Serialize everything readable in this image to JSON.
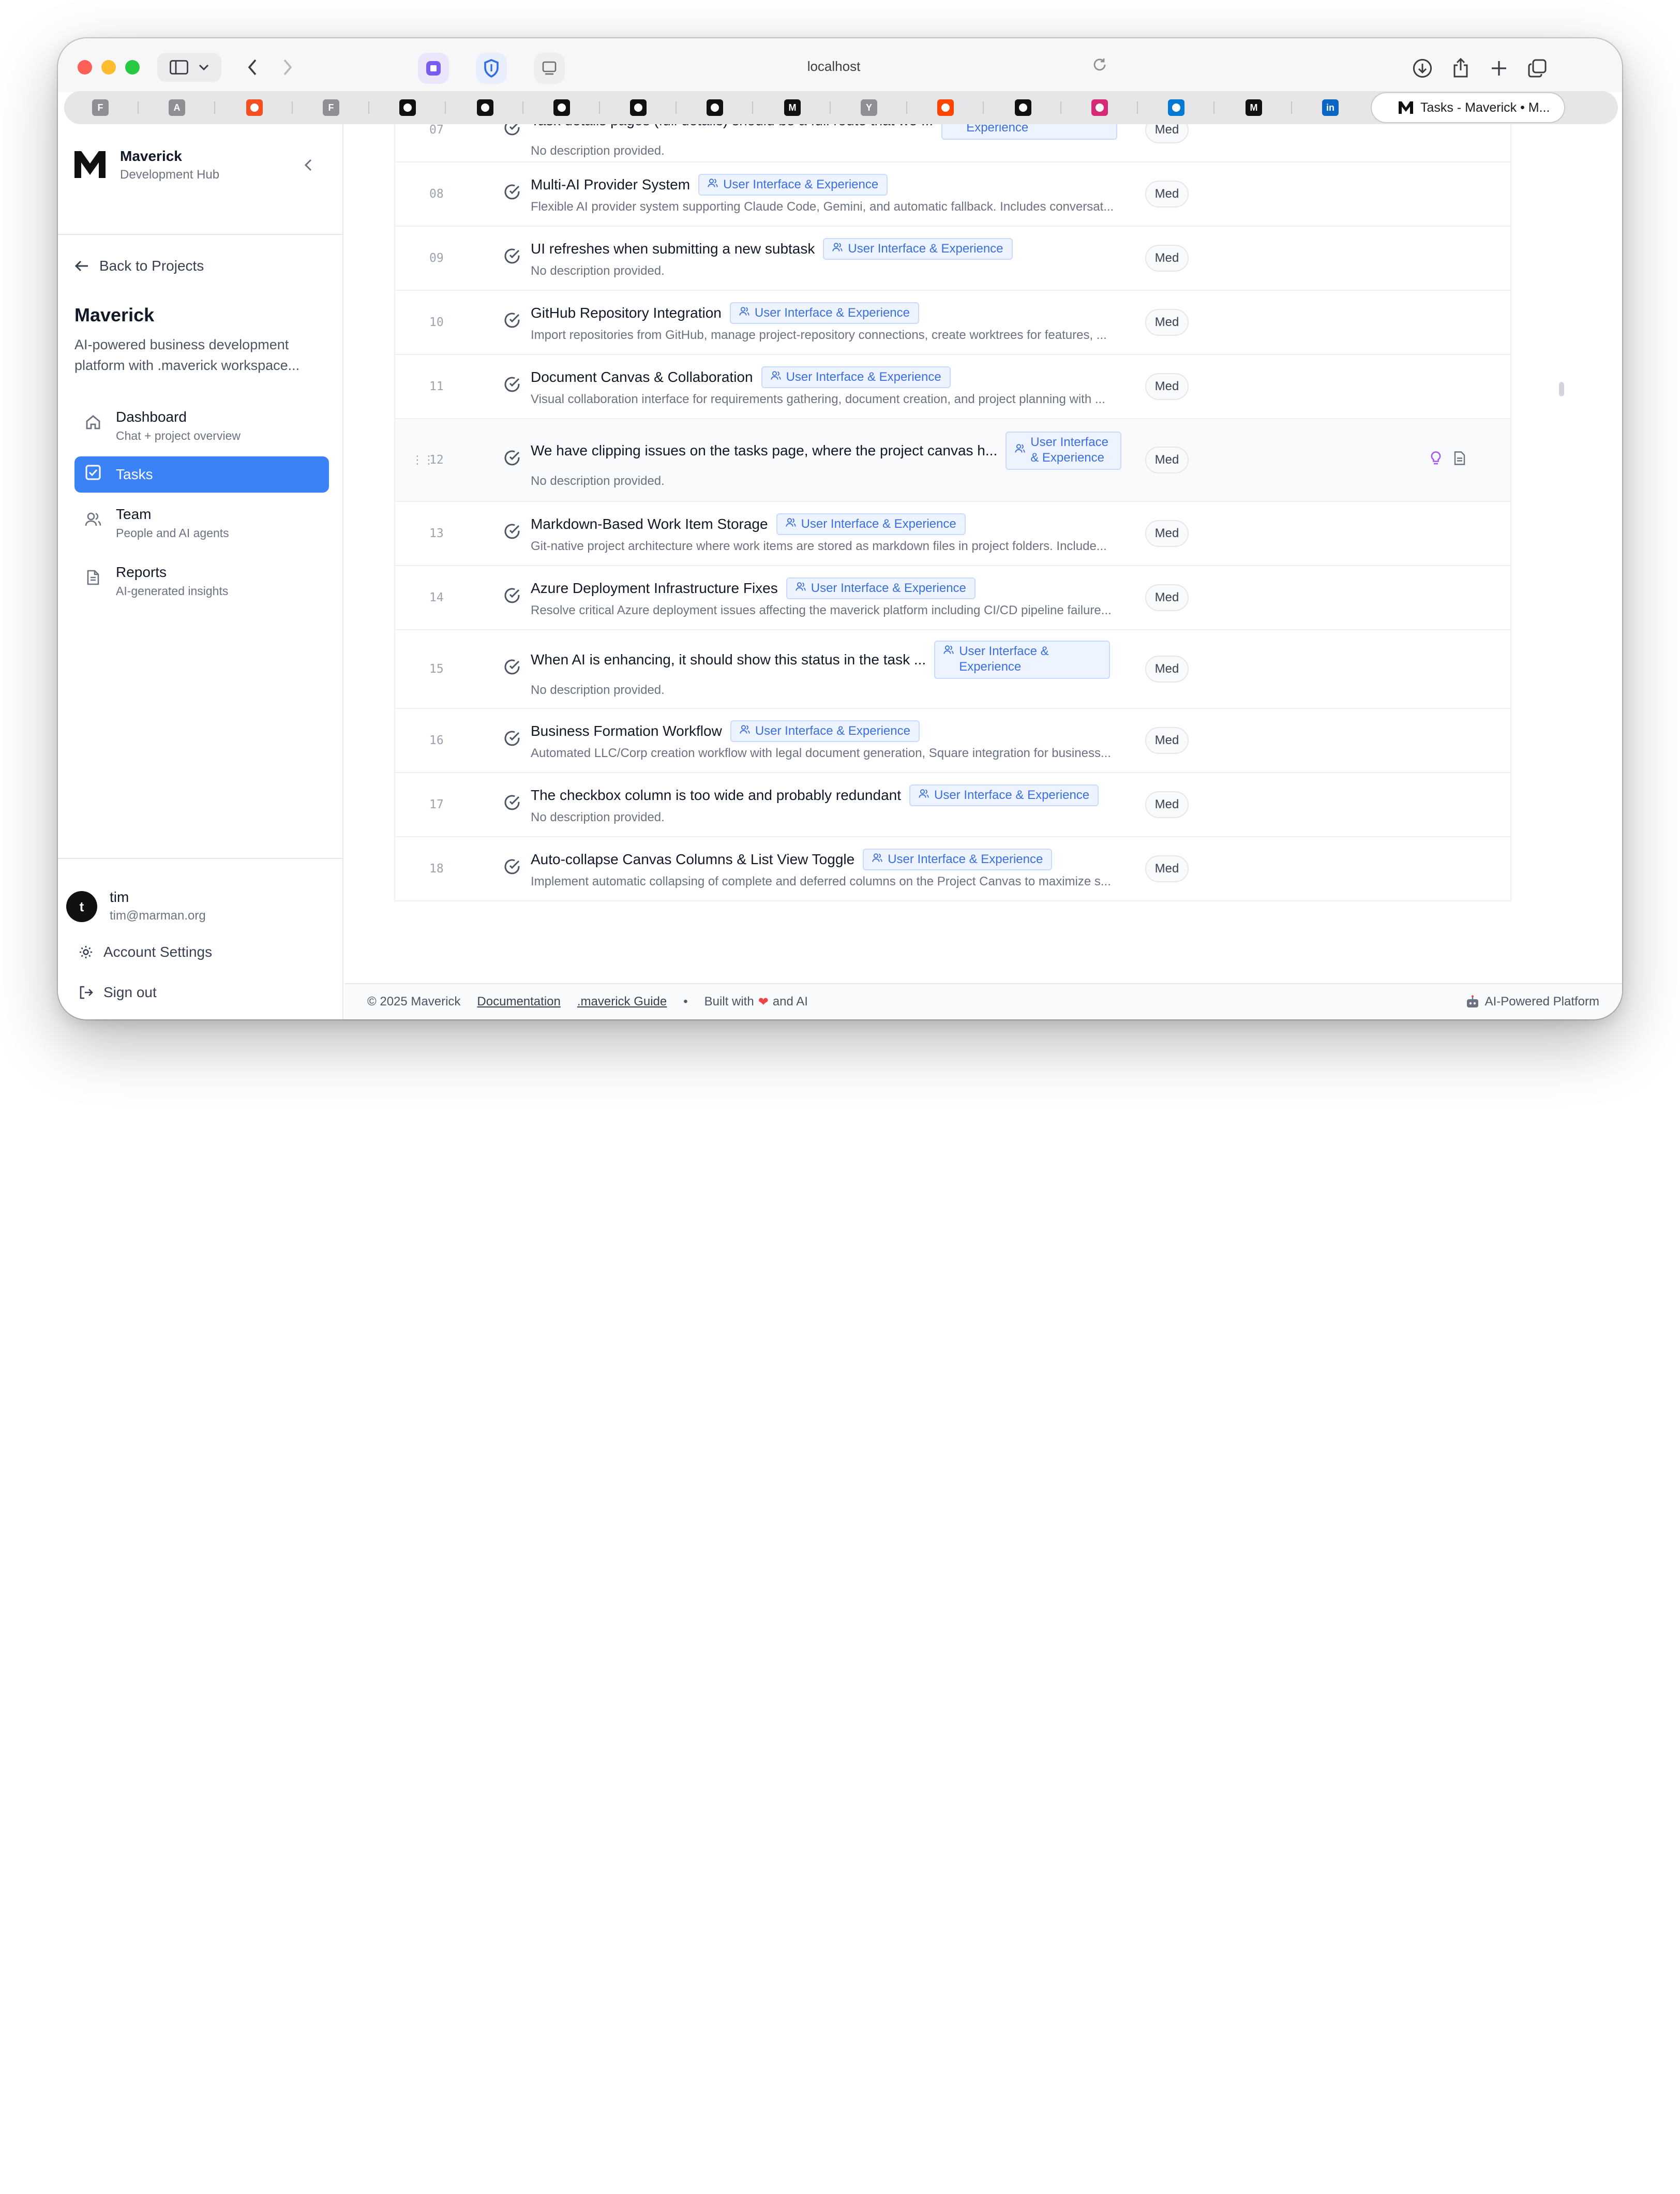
{
  "browser": {
    "address": "localhost",
    "active_tab_title": "Tasks - Maverick • M...",
    "pinned_tabs": [
      {
        "icon": "F",
        "color": "#8e8e93"
      },
      {
        "icon": "A",
        "color": "#8e8e93"
      },
      {
        "icon": "microsoft-icon",
        "color": "#f25022"
      },
      {
        "icon": "F",
        "color": "#8e8e93"
      },
      {
        "icon": "vercel-icon",
        "color": "#111111"
      },
      {
        "icon": "vercel-icon",
        "color": "#111111"
      },
      {
        "icon": "square-app-icon",
        "color": "#111111"
      },
      {
        "icon": "github-icon",
        "color": "#111111"
      },
      {
        "icon": "github-icon",
        "color": "#111111"
      },
      {
        "icon": "M",
        "color": "#111111"
      },
      {
        "icon": "Y",
        "color": "#8e8e93"
      },
      {
        "icon": "reddit-icon",
        "color": "#ff4500"
      },
      {
        "icon": "github-icon",
        "color": "#111111"
      },
      {
        "icon": "instagram-icon",
        "color": "#d62976"
      },
      {
        "icon": "azure-icon",
        "color": "#0078d4"
      },
      {
        "icon": "M",
        "color": "#111111"
      },
      {
        "icon": "in",
        "color": "#0a66c2"
      }
    ]
  },
  "sidebar": {
    "brand_name": "Maverick",
    "brand_sub": "Development Hub",
    "back_label": "Back to Projects",
    "project_name": "Maverick",
    "project_desc": "AI-powered business development platform with .maverick workspace...",
    "nav": [
      {
        "title": "Dashboard",
        "sub": "Chat + project overview",
        "icon": "home-icon"
      },
      {
        "title": "Tasks",
        "sub": "",
        "icon": "checkbox-icon"
      },
      {
        "title": "Team",
        "sub": "People and AI agents",
        "icon": "users-icon"
      },
      {
        "title": "Reports",
        "sub": "AI-generated insights",
        "icon": "document-icon"
      }
    ],
    "user": {
      "initial": "t",
      "name": "tim",
      "email": "tim@marman.org"
    },
    "account_settings": "Account Settings",
    "sign_out": "Sign out"
  },
  "tasks": [
    {
      "num": "07",
      "title": "Task details pages (full details) should be a full route that we ...",
      "tag": "User Interface & Experience",
      "desc": "No description provided.",
      "priority": "Med"
    },
    {
      "num": "08",
      "title": "Multi-AI Provider System",
      "tag": "User Interface & Experience",
      "desc": "Flexible AI provider system supporting Claude Code, Gemini, and automatic fallback. Includes conversat...",
      "priority": "Med"
    },
    {
      "num": "09",
      "title": "UI refreshes when submitting a new subtask",
      "tag": "User Interface & Experience",
      "desc": "No description provided.",
      "priority": "Med"
    },
    {
      "num": "10",
      "title": "GitHub Repository Integration",
      "tag": "User Interface & Experience",
      "desc": "Import repositories from GitHub, manage project-repository connections, create worktrees for features, ...",
      "priority": "Med"
    },
    {
      "num": "11",
      "title": "Document Canvas & Collaboration",
      "tag": "User Interface & Experience",
      "desc": "Visual collaboration interface for requirements gathering, document creation, and project planning with ...",
      "priority": "Med"
    },
    {
      "num": "12",
      "title": "We have clipping issues on the tasks page, where the project canvas h...",
      "tag": "User Interface & Experience",
      "desc": "No description provided.",
      "priority": "Med"
    },
    {
      "num": "13",
      "title": "Markdown-Based Work Item Storage",
      "tag": "User Interface & Experience",
      "desc": "Git-native project architecture where work items are stored as markdown files in project folders. Include...",
      "priority": "Med"
    },
    {
      "num": "14",
      "title": "Azure Deployment Infrastructure Fixes",
      "tag": "User Interface & Experience",
      "desc": "Resolve critical Azure deployment issues affecting the maverick platform including CI/CD pipeline failure...",
      "priority": "Med"
    },
    {
      "num": "15",
      "title": "When AI is enhancing, it should show this status in the task ...",
      "tag": "User Interface & Experience",
      "desc": "No description provided.",
      "priority": "Med"
    },
    {
      "num": "16",
      "title": "Business Formation Workflow",
      "tag": "User Interface & Experience",
      "desc": "Automated LLC/Corp creation workflow with legal document generation, Square integration for business...",
      "priority": "Med"
    },
    {
      "num": "17",
      "title": "The checkbox column is too wide and probably redundant",
      "tag": "User Interface & Experience",
      "desc": "No description provided.",
      "priority": "Med"
    },
    {
      "num": "18",
      "title": "Auto-collapse Canvas Columns & List View Toggle",
      "tag": "User Interface & Experience",
      "desc": "Implement automatic collapsing of complete and deferred columns on the Project Canvas to maximize s...",
      "priority": "Med"
    }
  ],
  "footer": {
    "copyright": "© 2025 Maverick",
    "doc_link": "Documentation",
    "guide_link": ".maverick Guide",
    "built_prefix": "Built with",
    "built_suffix": "and AI",
    "right": "AI-Powered Platform"
  }
}
